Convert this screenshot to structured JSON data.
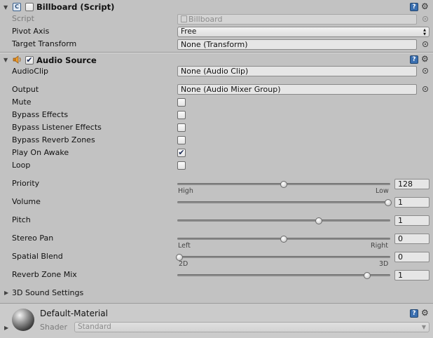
{
  "billboard": {
    "title": "Billboard (Script)",
    "script_label": "Script",
    "script_value": "Billboard",
    "pivot_axis_label": "Pivot Axis",
    "pivot_axis_value": "Free",
    "target_transform_label": "Target Transform",
    "target_transform_value": "None (Transform)"
  },
  "audio_source": {
    "title": "Audio Source",
    "audioclip_label": "AudioClip",
    "audioclip_value": "None (Audio Clip)",
    "output_label": "Output",
    "output_value": "None (Audio Mixer Group)",
    "toggles": [
      {
        "label": "Mute",
        "checked": false
      },
      {
        "label": "Bypass Effects",
        "checked": false
      },
      {
        "label": "Bypass Listener Effects",
        "checked": false
      },
      {
        "label": "Bypass Reverb Zones",
        "checked": false
      },
      {
        "label": "Play On Awake",
        "checked": true
      },
      {
        "label": "Loop",
        "checked": false
      }
    ],
    "sliders": {
      "priority": {
        "label": "Priority",
        "value": "128",
        "fraction": 0.5,
        "min_label": "High",
        "max_label": "Low"
      },
      "volume": {
        "label": "Volume",
        "value": "1",
        "fraction": 1.0
      },
      "pitch": {
        "label": "Pitch",
        "value": "1",
        "fraction": 0.667
      },
      "stereo_pan": {
        "label": "Stereo Pan",
        "value": "0",
        "fraction": 0.5,
        "min_label": "Left",
        "max_label": "Right"
      },
      "spatial_blend": {
        "label": "Spatial Blend",
        "value": "0",
        "fraction": 0.0,
        "min_label": "2D",
        "max_label": "3D"
      },
      "reverb_zone_mix": {
        "label": "Reverb Zone Mix",
        "value": "1",
        "fraction": 0.9
      }
    },
    "sound_settings_label": "3D Sound Settings"
  },
  "material": {
    "name": "Default-Material",
    "shader_label": "Shader",
    "shader_value": "Standard"
  },
  "icons": {
    "help": "?",
    "gear": "⚙",
    "checkmark": "✔",
    "foldout_open": "▼",
    "foldout_closed": "▶"
  },
  "colors": {
    "panel_bg": "#c2c2c2",
    "field_bg": "#e6e6e6",
    "help_icon_bg": "#3a6fb0"
  }
}
